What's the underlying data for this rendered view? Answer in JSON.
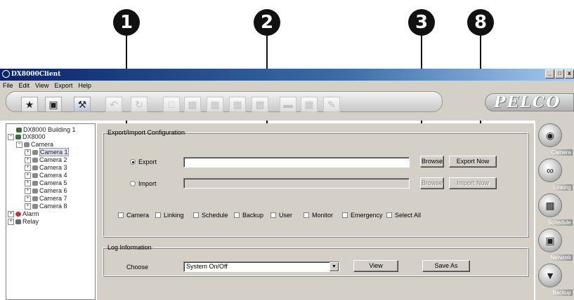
{
  "window": {
    "title": "DX8000Client",
    "controls": [
      "_",
      "□",
      "x"
    ]
  },
  "menu": [
    "File",
    "Edit",
    "View",
    "Export",
    "Help"
  ],
  "toolbar": {
    "buttons": [
      {
        "icon": "person-icon"
      },
      {
        "icon": "camera-icon"
      },
      {
        "icon": "tools-icon"
      },
      {
        "icon": "undo-icon"
      },
      {
        "icon": "refresh-icon"
      },
      {
        "icon": "layout-1-icon"
      },
      {
        "icon": "layout-4-icon"
      },
      {
        "icon": "layout-9-icon"
      },
      {
        "icon": "layout-16-icon"
      },
      {
        "icon": "layout-mixed-icon"
      },
      {
        "icon": "sequence-icon"
      },
      {
        "icon": "grid-icon"
      },
      {
        "icon": "edit-icon"
      }
    ],
    "brand": "PELCO"
  },
  "tree": {
    "items": [
      {
        "label": "DX8000 Building 1",
        "level": 0,
        "expander": "",
        "icon": "server"
      },
      {
        "label": "DX8000",
        "level": 0,
        "expander": "−",
        "icon": "server"
      },
      {
        "label": "Camera",
        "level": 1,
        "expander": "−",
        "icon": "camera"
      },
      {
        "label": "Camera 1",
        "level": 2,
        "expander": "+",
        "icon": "camera",
        "selected": true
      },
      {
        "label": "Camera 2",
        "level": 2,
        "expander": "+",
        "icon": "camera"
      },
      {
        "label": "Camera 3",
        "level": 2,
        "expander": "+",
        "icon": "camera"
      },
      {
        "label": "Camera 4",
        "level": 2,
        "expander": "+",
        "icon": "camera"
      },
      {
        "label": "Camera 5",
        "level": 2,
        "expander": "+",
        "icon": "camera"
      },
      {
        "label": "Camera 6",
        "level": 2,
        "expander": "+",
        "icon": "camera"
      },
      {
        "label": "Camera 7",
        "level": 2,
        "expander": "+",
        "icon": "camera"
      },
      {
        "label": "Camera 8",
        "level": 2,
        "expander": "+",
        "icon": "camera"
      },
      {
        "label": "Alarm",
        "level": 1,
        "expander": "+",
        "icon": "alarm"
      },
      {
        "label": "Relay",
        "level": 1,
        "expander": "+",
        "icon": "relay"
      }
    ]
  },
  "export_import": {
    "group_label": "Export/Import Configuration",
    "export_label": "Export",
    "import_label": "Import",
    "export_path": "",
    "import_path": "",
    "browse_label": "Browse",
    "export_now_label": "Export Now",
    "import_now_label": "Import Now",
    "checkboxes": [
      "Camera",
      "Linking",
      "Schedule",
      "Backup",
      "User",
      "Monitor",
      "Emergency",
      "Select All"
    ]
  },
  "log": {
    "group_label": "Log Information",
    "choose_label": "Choose",
    "selected": "System On/Off",
    "view_label": "View",
    "save_as_label": "Save As"
  },
  "side_nav": [
    "Camera",
    "Linking",
    "Schedule",
    "Network",
    "Backup"
  ],
  "callouts": [
    "1",
    "2",
    "3",
    "8"
  ]
}
